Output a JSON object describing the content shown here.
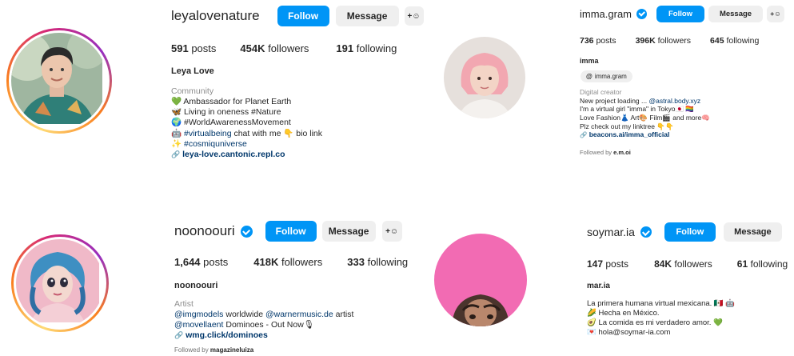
{
  "p1": {
    "username": "leyalovenature",
    "follow": "Follow",
    "message": "Message",
    "add_icon": "+☺",
    "posts": "591",
    "posts_label": "posts",
    "followers": "454K",
    "followers_label": "followers",
    "following": "191",
    "following_label": "following",
    "display_name": "Leya Love",
    "category": "Community",
    "bio": [
      "💚 Ambassador for Planet Earth",
      "🦋 Living in oneness #Nature",
      "🌍 #WorldAwarenessMovement"
    ],
    "bio4_pre": "🤖 ",
    "bio4_tag": "#virtualbeing",
    "bio4_post": " chat with me 👇 bio link",
    "bio5_icon": "✨",
    "bio5_tag": "#cosmiquniverse",
    "link": "leya-love.cantonic.repl.co"
  },
  "p2": {
    "username": "imma.gram",
    "follow": "Follow",
    "message": "Message",
    "add_icon": "+☺",
    "posts": "736",
    "posts_label": "posts",
    "followers": "396K",
    "followers_label": "followers",
    "following": "645",
    "following_label": "following",
    "display_name": "imma",
    "threads_handle": "imma.gram",
    "category": "Digital creator",
    "bio1_pre": "New project loading ... ",
    "bio1_tag": "@astral.body.xyz",
    "bio2": "I'm a virtual girl \"imma\" in Tokyo🇯🇵 🏳️‍🌈",
    "bio3": "Love Fashion👗 Art🎨 Film🎬 and more🧠",
    "bio4": "Plz check out my linktree 👇👇",
    "link": "beacons.ai/imma_official",
    "followed_by_pre": "Followed by ",
    "followed_by": "e.m.oi"
  },
  "p3": {
    "username": "noonoouri",
    "follow": "Follow",
    "message": "Message",
    "add_icon": "+☺",
    "posts": "1,644",
    "posts_label": "posts",
    "followers": "418K",
    "followers_label": "followers",
    "following": "333",
    "following_label": "following",
    "display_name": "noonoouri",
    "category": "Artist",
    "bio1_tag1": "@imgmodels",
    "bio1_mid": " worldwide ",
    "bio1_tag2": "@warnermusic.de",
    "bio1_post": " artist",
    "bio2_tag": "@movellaent",
    "bio2_post": " Dominoes - Out Now🎙",
    "link": "wmg.click/dominoes",
    "followed_by_pre": "Followed by ",
    "followed_by": "magazineluiza"
  },
  "p4": {
    "username": "soymar.ia",
    "follow": "Follow",
    "message": "Message",
    "posts": "147",
    "posts_label": "posts",
    "followers": "84K",
    "followers_label": "followers",
    "following": "61",
    "following_label": "following",
    "display_name": "mar.ia",
    "bio": [
      "La primera humana virtual mexicana. 🇲🇽 🤖",
      "🌽 Hecha en México.",
      "🥑 La comida es mi verdadero amor. 💚",
      "💌 hola@soymar-ia.com"
    ]
  },
  "icons": {
    "link": "🔗",
    "threads": "@"
  },
  "colors": {
    "follow": "#0095f6",
    "secondary": "#efefef",
    "link": "#00376b",
    "muted": "#8e8e8e"
  }
}
